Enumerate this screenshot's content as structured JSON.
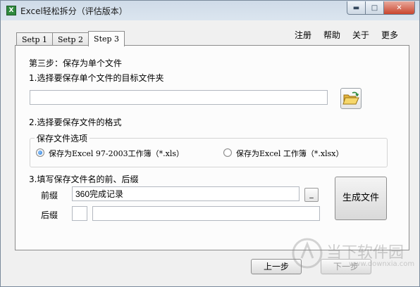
{
  "titlebar": {
    "title": "Excel轻松拆分（评估版本）",
    "minimize_icon": "minimize-icon",
    "maximize_icon": "maximize-icon",
    "close_icon": "close-icon"
  },
  "tabs": [
    {
      "label": "Setp 1"
    },
    {
      "label": "Setp 2"
    },
    {
      "label": "Step 3",
      "active": true
    }
  ],
  "menu": {
    "register": "注册",
    "help": "帮助",
    "about": "关于",
    "more": "更多"
  },
  "step": {
    "heading": "第三步：保存为单个文件",
    "section1_label": "1.选择要保存单个文件的目标文件夹",
    "folder_path_value": "",
    "section2_label": "2.选择要保存文件的格式",
    "options_group_label": "保存文件选项",
    "option_xls": "保存为Excel 97-2003工作簿（*.xls）",
    "option_xlsx": "保存为Excel 工作簿（*.xlsx）",
    "selected_format": "xls",
    "section3_label": "3.填写保存文件名的前、后缀",
    "prefix_label": "前缀",
    "prefix_value": "360完成记录",
    "prefix_button": "_",
    "suffix_label": "后缀",
    "suffix_value": "",
    "suffix_value2": "",
    "generate_button": "生成文件"
  },
  "footer": {
    "prev_button": "上一步",
    "next_button": "下一步"
  },
  "watermark": {
    "text": "当下软件园",
    "url": "www.downxia.com"
  }
}
